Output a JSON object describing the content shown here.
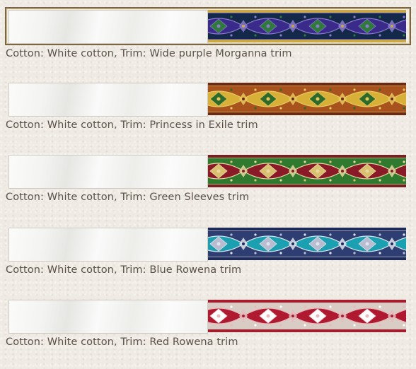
{
  "options": [
    {
      "caption": "Cotton: White cotton, Trim: Wide purple Morganna trim",
      "selected": true,
      "trim_icon": "purple-morganna-trim-swatch",
      "colors": {
        "bg": "#14284a",
        "band": "#c8a84a",
        "main": "#3a2a8a",
        "accent": "#2f7a3a",
        "detail": "#8a7ad0"
      }
    },
    {
      "caption": "Cotton: White cotton, Trim: Princess in Exile trim",
      "selected": false,
      "trim_icon": "princess-in-exile-trim-swatch",
      "colors": {
        "bg": "#a8521e",
        "band": "#6a2a14",
        "main": "#d8b038",
        "accent": "#2e6a2a",
        "detail": "#e8c860"
      }
    },
    {
      "caption": "Cotton: White cotton, Trim: Green Sleeves trim",
      "selected": false,
      "trim_icon": "green-sleeves-trim-swatch",
      "colors": {
        "bg": "#2f7a2e",
        "band": "#7a1e24",
        "main": "#8a1a28",
        "accent": "#d8c070",
        "detail": "#e8d8a0"
      }
    },
    {
      "caption": "Cotton: White cotton, Trim: Blue Rowena trim",
      "selected": false,
      "trim_icon": "blue-rowena-trim-swatch",
      "colors": {
        "bg": "#2e3e72",
        "band": "#1e2a58",
        "main": "#1aa0b0",
        "accent": "#b8bcd0",
        "detail": "#e0e4ee"
      }
    },
    {
      "caption": "Cotton: White cotton, Trim: Red Rowena trim",
      "selected": false,
      "trim_icon": "red-rowena-trim-swatch",
      "colors": {
        "bg": "#d8ccc4",
        "band": "#a01e2e",
        "main": "#b01a30",
        "accent": "#ffffff",
        "detail": "#e8b8bc"
      }
    }
  ]
}
